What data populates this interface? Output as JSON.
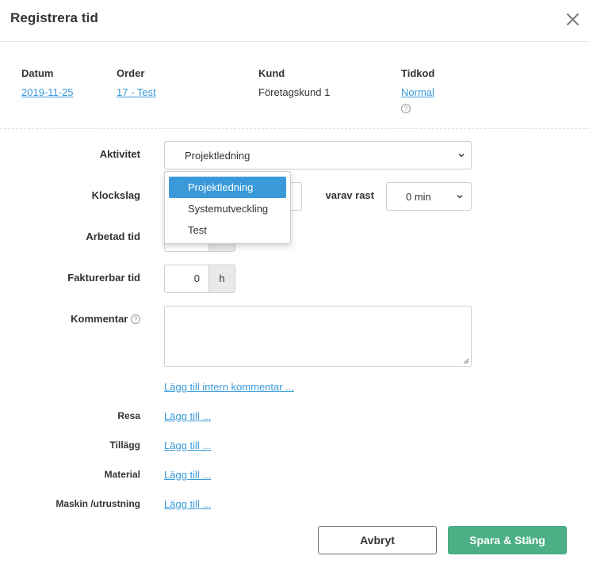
{
  "modal": {
    "title": "Registrera tid",
    "close_icon": "close-icon"
  },
  "info": {
    "datum": {
      "label": "Datum",
      "value": "2019-11-25"
    },
    "order": {
      "label": "Order",
      "value": "17 - Test"
    },
    "kund": {
      "label": "Kund",
      "value": "Företagskund 1"
    },
    "tidkod": {
      "label": "Tidkod",
      "value": "Normal",
      "help_icon": "help-icon"
    }
  },
  "form": {
    "aktivitet": {
      "label": "Aktivitet",
      "value": "Projektledning",
      "options": [
        "Projektledning",
        "Systemutveckling",
        "Test"
      ],
      "highlighted_option": "Projektledning"
    },
    "klockslag": {
      "label": "Klockslag"
    },
    "rast": {
      "label": "varav rast",
      "value": "0 min"
    },
    "arbetad_tid": {
      "label": "Arbetad tid"
    },
    "fakturerbar_tid": {
      "label": "Fakturerbar tid",
      "value": "0",
      "unit": "h"
    },
    "kommentar": {
      "label": "Kommentar",
      "value": ""
    },
    "intern_kommentar_link": "Lägg till intern kommentar ...",
    "resa": {
      "label": "Resa",
      "link": "Lägg till ..."
    },
    "tillagg": {
      "label": "Tillägg",
      "link": "Lägg till ..."
    },
    "material": {
      "label": "Material",
      "link": "Lägg till ..."
    },
    "maskin": {
      "label": "Maskin /utrustning",
      "link": "Lägg till ..."
    }
  },
  "footer": {
    "cancel_label": "Avbryt",
    "save_label": "Spara & Stäng"
  },
  "colors": {
    "link": "#3a9ad9",
    "primary": "#4caf85",
    "selected_option": "#3a9ad9"
  }
}
